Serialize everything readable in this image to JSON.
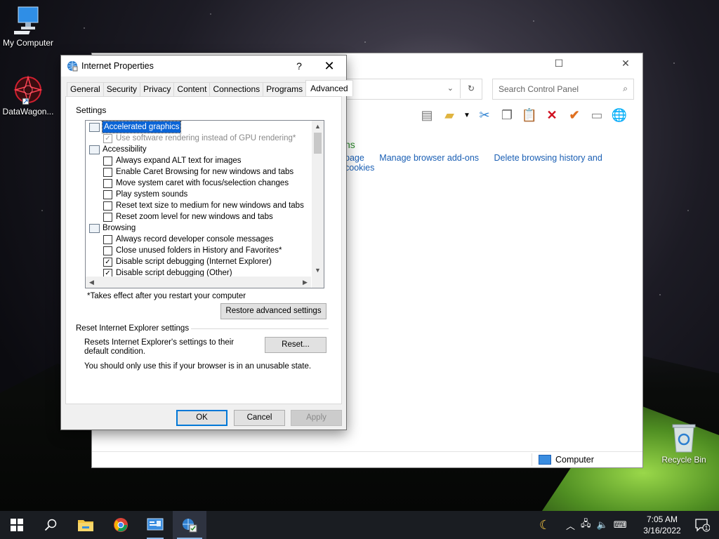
{
  "desktop": {
    "icons": [
      {
        "label": "My Computer"
      },
      {
        "label": "DataWagon..."
      },
      {
        "label": "Recycle Bin"
      }
    ]
  },
  "control_panel": {
    "search_placeholder": "Search Control Panel",
    "heading_fragment": "ns",
    "links": [
      "page",
      "Manage browser add-ons",
      "Delete browsing history and cookies"
    ],
    "status_text": "Computer"
  },
  "dialog": {
    "title": "Internet Properties",
    "help": "?",
    "close": "✕",
    "tabs": [
      "General",
      "Security",
      "Privacy",
      "Content",
      "Connections",
      "Programs",
      "Advanced"
    ],
    "active_tab": "Advanced",
    "settings_label": "Settings",
    "settings_items": [
      {
        "type": "category",
        "text": "Accelerated graphics",
        "selected": true
      },
      {
        "type": "check",
        "text": "Use software rendering instead of GPU rendering*",
        "checked": true,
        "disabled": true
      },
      {
        "type": "category",
        "text": "Accessibility"
      },
      {
        "type": "check",
        "text": "Always expand ALT text for images",
        "checked": false
      },
      {
        "type": "check",
        "text": "Enable Caret Browsing for new windows and tabs",
        "checked": false
      },
      {
        "type": "check",
        "text": "Move system caret with focus/selection changes",
        "checked": false
      },
      {
        "type": "check",
        "text": "Play system sounds",
        "checked": false
      },
      {
        "type": "check",
        "text": "Reset text size to medium for new windows and tabs",
        "checked": false
      },
      {
        "type": "check",
        "text": "Reset zoom level for new windows and tabs",
        "checked": false
      },
      {
        "type": "category",
        "text": "Browsing"
      },
      {
        "type": "check",
        "text": "Always record developer console messages",
        "checked": false
      },
      {
        "type": "check",
        "text": "Close unused folders in History and Favorites*",
        "checked": false
      },
      {
        "type": "check",
        "text": "Disable script debugging (Internet Explorer)",
        "checked": true
      },
      {
        "type": "check",
        "text": "Disable script debugging (Other)",
        "checked": true
      }
    ],
    "restart_note": "*Takes effect after you restart your computer",
    "restore_button": "Restore advanced settings",
    "reset_group_title": "Reset Internet Explorer settings",
    "reset_description": "Resets Internet Explorer's settings to their default condition.",
    "reset_button": "Reset...",
    "reset_warning": "You should only use this if your browser is in an unusable state.",
    "ok": "OK",
    "cancel": "Cancel",
    "apply": "Apply"
  },
  "taskbar": {
    "time": "7:05 AM",
    "date": "3/16/2022",
    "notification_count": "1"
  }
}
